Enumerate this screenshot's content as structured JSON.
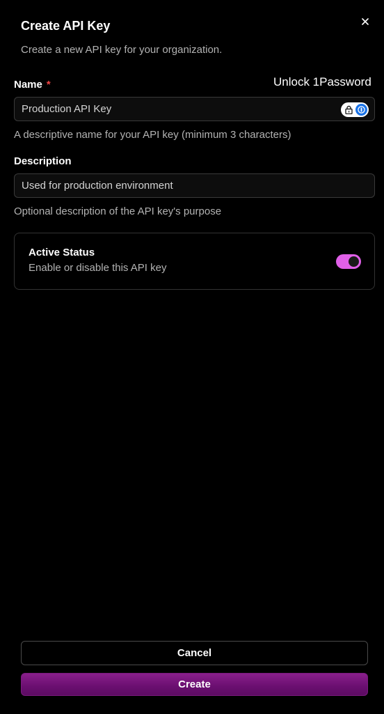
{
  "dialog": {
    "title": "Create API Key",
    "subtitle": "Create a new API key for your organization.",
    "close_icon": "close-icon"
  },
  "form": {
    "name": {
      "label": "Name",
      "required_mark": "*",
      "value": "Production API Key",
      "help": "A descriptive name for your API key (minimum 3 characters)"
    },
    "password_manager": {
      "hint": "Unlock 1Password",
      "icons": [
        "lock-icon",
        "onepassword-icon"
      ]
    },
    "description": {
      "label": "Description",
      "value": "Used for production environment",
      "help": "Optional description of the API key's purpose"
    },
    "active_status": {
      "title": "Active Status",
      "description": "Enable or disable this API key",
      "enabled": true
    }
  },
  "actions": {
    "cancel_label": "Cancel",
    "create_label": "Create"
  },
  "colors": {
    "background": "#000000",
    "accent": "#e060e8",
    "primary_button": "#6a0f70",
    "required": "#ef4444"
  }
}
